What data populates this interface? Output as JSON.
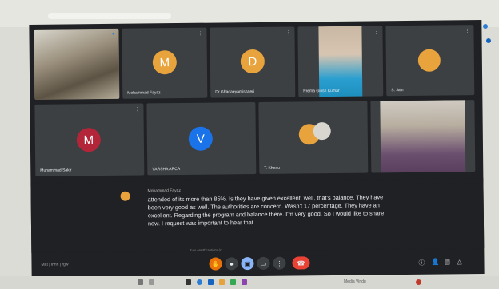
{
  "browser": {
    "tab_title": "",
    "address": ""
  },
  "tiles": [
    {
      "name": "",
      "kind": "video"
    },
    {
      "name": "Mohammad Fayaz",
      "initial": "M",
      "color": "#e8a33d"
    },
    {
      "name": "Dr Ghadaeyamishaeri",
      "initial": "D",
      "color": "#e8a33d"
    },
    {
      "name": "Prema Girish Kumar",
      "kind": "video"
    },
    {
      "name": "S. Jain",
      "initial": "",
      "color": "#e8a33d"
    },
    {
      "name": "Muhammad Sakir",
      "initial": "M",
      "color": "#b3263a"
    },
    {
      "name": "VARSHA ARCA",
      "initial": "V",
      "color": "#1a73e8"
    },
    {
      "name": "T. Kheau",
      "initial": "",
      "color": "#e8a33d"
    },
    {
      "name": "",
      "kind": "video"
    }
  ],
  "captions": {
    "speaker": "Mohammad Fayaz",
    "text": "attended of its more than 85%. Is they have given excellent, well, that's balance. They have been very good as well. The authorities are concern. Wasn't 17 percentage. They have an excellent. Regarding the program and balance there. I'm very good. So I would like to share now. I request was important to hear that."
  },
  "controls": {
    "meeting_info": "Mat | lnnn | rgw",
    "tooltip": "Turn on/off captions (c)"
  },
  "taskbar": {
    "status": "Media Vindu"
  }
}
